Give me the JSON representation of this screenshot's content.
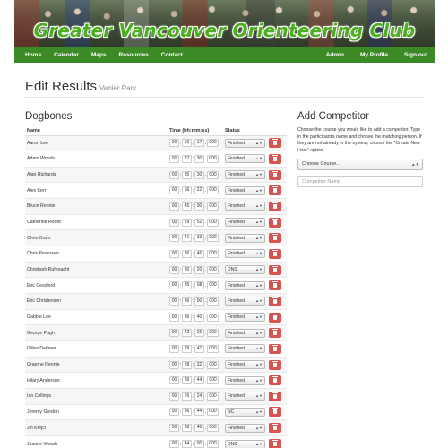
{
  "banner": {
    "title": "Greater Vancouver Orienteering Club"
  },
  "nav": {
    "left": [
      "Home",
      "Calendar",
      "Maps",
      "Resources",
      "Contact"
    ],
    "right": [
      "Admin",
      "My Profile",
      "Sign out"
    ]
  },
  "page": {
    "title": "Edit Results",
    "subtitle": "Vanier Park"
  },
  "results": {
    "heading": "Dogbones",
    "columns": {
      "name": "Name",
      "time": "Time (hh:mm:ss)",
      "status": "Status"
    },
    "rows": [
      {
        "name": "Aaron Lee",
        "hh": "00",
        "mm": "56",
        "ss": "17",
        "ms": "000",
        "status": "Finished"
      },
      {
        "name": "Adam Woods",
        "hh": "00",
        "mm": "27",
        "ss": "30",
        "ms": "000",
        "status": "Finished"
      },
      {
        "name": "Alan Richards",
        "hh": "00",
        "mm": "35",
        "ss": "30",
        "ms": "000",
        "status": "Finished"
      },
      {
        "name": "Alex Kerr",
        "hh": "00",
        "mm": "56",
        "ss": "22",
        "ms": "000",
        "status": "Finished"
      },
      {
        "name": "Bruce Rennie",
        "hh": "00",
        "mm": "45",
        "ss": "00",
        "ms": "000",
        "status": "Finished"
      },
      {
        "name": "Catherine Hoofd",
        "hh": "00",
        "mm": "29",
        "ss": "52",
        "ms": "000",
        "status": "Finished"
      },
      {
        "name": "Chris Oram",
        "hh": "00",
        "mm": "41",
        "ss": "33",
        "ms": "000",
        "status": "Finished"
      },
      {
        "name": "Chris Pedersen",
        "hh": "00",
        "mm": "36",
        "ss": "46",
        "ms": "000",
        "status": "Finished"
      },
      {
        "name": "Christoph Rufenacht",
        "hh": "00",
        "mm": "30",
        "ss": "20",
        "ms": "000",
        "status": "DNS"
      },
      {
        "name": "Eric Cessford",
        "hh": "00",
        "mm": "35",
        "ss": "08",
        "ms": "000",
        "status": "Finished"
      },
      {
        "name": "Eric Christensen",
        "hh": "00",
        "mm": "36",
        "ss": "00",
        "ms": "000",
        "status": "Finished"
      },
      {
        "name": "Gabbie Lee",
        "hh": "00",
        "mm": "36",
        "ss": "40",
        "ms": "000",
        "status": "Finished"
      },
      {
        "name": "George Pugh",
        "hh": "00",
        "mm": "42",
        "ss": "26",
        "ms": "000",
        "status": "Finished"
      },
      {
        "name": "Gilles Delmee",
        "hh": "00",
        "mm": "29",
        "ss": "47",
        "ms": "000",
        "status": "Finished"
      },
      {
        "name": "Graeme Rennie",
        "hh": "00",
        "mm": "28",
        "ss": "32",
        "ms": "000",
        "status": "Finished"
      },
      {
        "name": "Hilary Anderson",
        "hh": "00",
        "mm": "39",
        "ss": "44",
        "ms": "000",
        "status": "Finished"
      },
      {
        "name": "Ian Collings",
        "hh": "00",
        "mm": "26",
        "ss": "24",
        "ms": "000",
        "status": "Finished"
      },
      {
        "name": "Jeremy Gordon",
        "hh": "00",
        "mm": "36",
        "ss": "44",
        "ms": "000",
        "status": "NC"
      },
      {
        "name": "Jiri Krejci",
        "hh": "00",
        "mm": "38",
        "ss": "48",
        "ms": "000",
        "status": "Finished"
      },
      {
        "name": "Joanne Woods",
        "hh": "00",
        "mm": "44",
        "ss": "00",
        "ms": "000",
        "status": "DNS"
      }
    ]
  },
  "add_competitor": {
    "heading": "Add Competitor",
    "description": "Choose the course you would like to add a competitor. Type in the participant's name and choose the matching person. If they are not already in the system, choose the \"Create New User\" option.",
    "course_select": "Choose Course..",
    "name_placeholder": "Competitor Name"
  },
  "icons": {
    "delete": "trash-icon",
    "dropdown": "caret-updown-icon"
  },
  "colors": {
    "nav_bg": "#3c8a25",
    "banner_text": "#4caf1f",
    "delete_btn": "#d9534f"
  }
}
